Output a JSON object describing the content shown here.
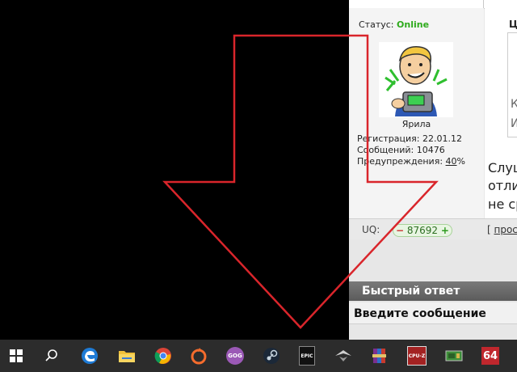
{
  "profile": {
    "status_label": "Статус:",
    "status_value": "Online",
    "username": "Ярила",
    "registration": "Регистрация: 22.01.12",
    "messages": "Сообщений: 10476",
    "warnings_label": "Предупреждения: ",
    "warnings_value": "40",
    "warnings_unit": "%"
  },
  "uq": {
    "label": "UQ:",
    "minus": "−",
    "value": "87692",
    "plus": "+",
    "link_open": "[ ",
    "link_text": "прос"
  },
  "post": {
    "quote_header": "Ц",
    "quote_lines": [
      "К",
      "И"
    ],
    "lines": [
      "Слуш",
      "отлич",
      "не ср"
    ]
  },
  "quick_reply": {
    "title": "Быстрый ответ",
    "message_label": "Введите сообщение"
  },
  "taskbar": {
    "icons": [
      "windows-start-icon",
      "search-icon",
      "edge-icon",
      "file-explorer-icon",
      "chrome-icon",
      "origin-icon",
      "gog-galaxy-icon",
      "steam-icon",
      "epic-games-icon",
      "aorus-icon",
      "winrar-icon",
      "cpu-z-icon",
      "gpu-z-icon",
      "aida64-icon"
    ],
    "epic_text": "EPIC",
    "gog_text": "GOG",
    "cpuz_text": "CPU-Z",
    "aida_text": "64"
  },
  "colors": {
    "annotation_arrow": "#d9252b",
    "online": "#2eaa1c",
    "taskbar": "#2c2c2c"
  }
}
